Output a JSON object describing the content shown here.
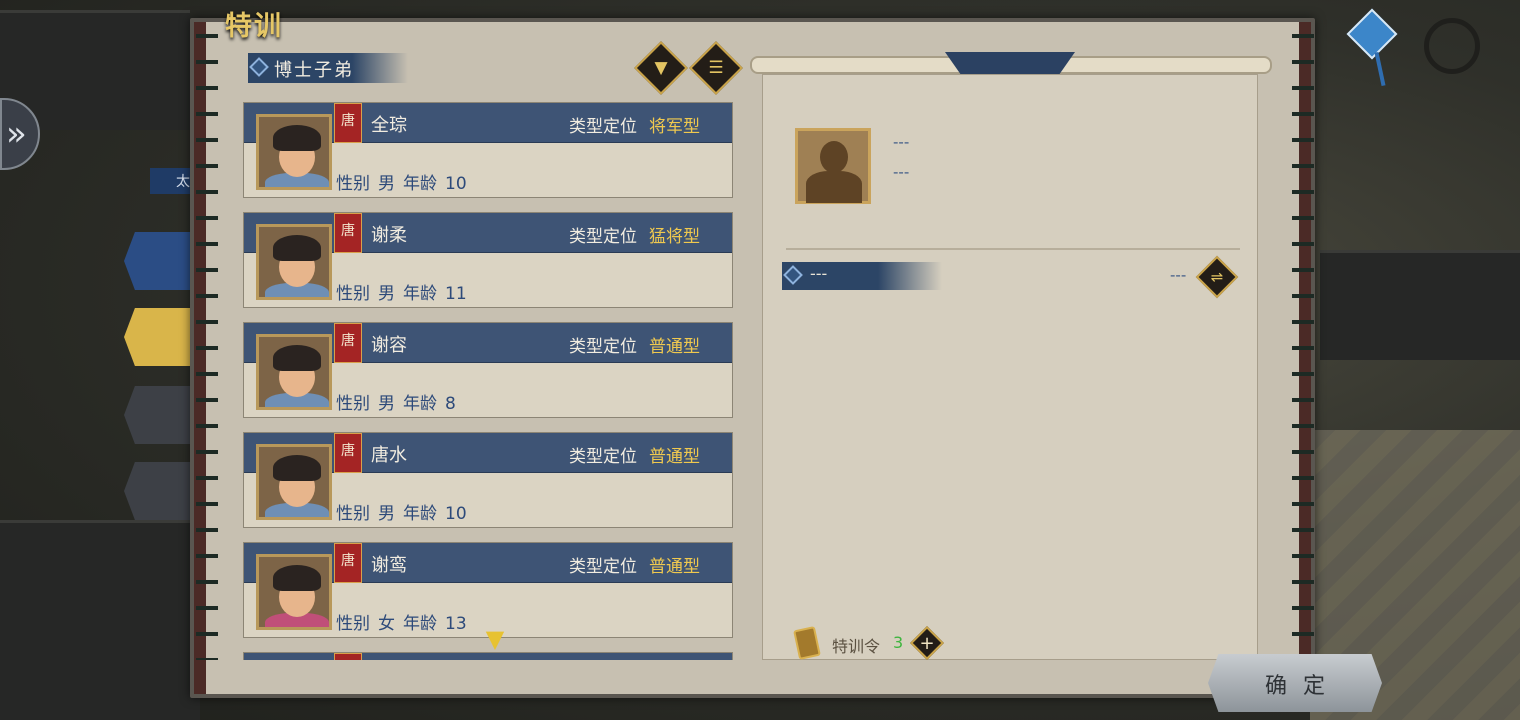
{
  "window": {
    "title": "特训"
  },
  "sidebar": {
    "tag": "太"
  },
  "list": {
    "category": "博士子弟",
    "filter_icon": "filter-icon",
    "sort_icon": "list-icon",
    "type_label": "类型定位",
    "gender_label": "性别",
    "age_label": "年龄",
    "scroll_icon": "chevron-down-icon",
    "students": [
      {
        "clan": "唐",
        "name": "全琮",
        "type": "将军型",
        "gender": "男",
        "age": "10",
        "portrait": "boy-portrait"
      },
      {
        "clan": "唐",
        "name": "谢柔",
        "type": "猛将型",
        "gender": "男",
        "age": "11",
        "portrait": "boy-portrait"
      },
      {
        "clan": "唐",
        "name": "谢容",
        "type": "普通型",
        "gender": "男",
        "age": "8",
        "portrait": "boy-portrait"
      },
      {
        "clan": "唐",
        "name": "唐水",
        "type": "普通型",
        "gender": "男",
        "age": "10",
        "portrait": "boy-portrait"
      },
      {
        "clan": "唐",
        "name": "谢鸾",
        "type": "普通型",
        "gender": "女",
        "age": "13",
        "portrait": "girl-portrait"
      }
    ]
  },
  "detail": {
    "line1": "---",
    "line2": "---",
    "sub_title": "---",
    "sub_value": "---",
    "swap_icon": "swap-icon"
  },
  "footer": {
    "token_label": "特训令",
    "token_count": "3",
    "add_icon": "plus-icon",
    "confirm_label": "确定"
  },
  "colors": {
    "accent_gold": "#f0c94f",
    "header_blue": "#3e5475",
    "clan_red": "#a42424",
    "count_green": "#3fb53f"
  }
}
